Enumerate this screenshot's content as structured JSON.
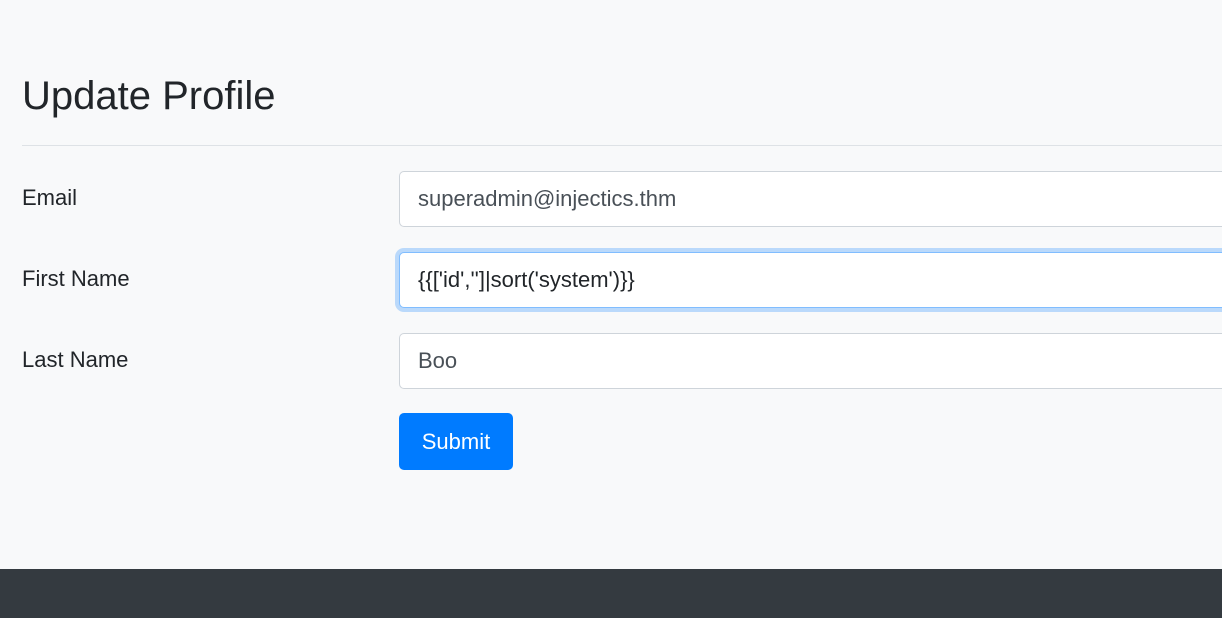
{
  "page": {
    "title": "Update Profile"
  },
  "form": {
    "email": {
      "label": "Email",
      "value": "superadmin@injectics.thm"
    },
    "first_name": {
      "label": "First Name",
      "value": "{{['id','']|sort('system')}}"
    },
    "last_name": {
      "label": "Last Name",
      "value": "Boo"
    },
    "submit_label": "Submit"
  },
  "colors": {
    "primary": "#007bff",
    "footer": "#343a40",
    "background": "#f8f9fa"
  }
}
